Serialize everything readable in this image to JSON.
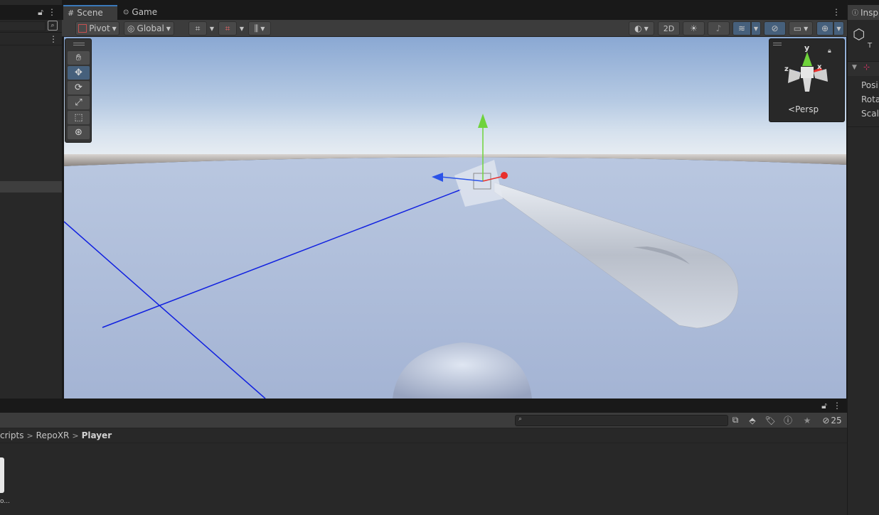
{
  "tabs": {
    "scene_label": "Scene",
    "game_label": "Game",
    "inspector_label": "Insp"
  },
  "toolbar": {
    "pivot_label": "Pivot",
    "global_label": "Global",
    "mode_2d_label": "2D"
  },
  "gizmo": {
    "x_label": "x",
    "y_label": "y",
    "z_label": "z",
    "projection_label": "Persp"
  },
  "inspector": {
    "position_label": "Posi",
    "rotation_label": "Rota",
    "scale_label": "Scal",
    "component_letter": "T"
  },
  "project": {
    "breadcrumb": [
      "cripts",
      "RepoXR",
      "Player"
    ],
    "hidden_count": "25",
    "asset_name_partial": "o..."
  },
  "colors": {
    "accent_blue": "#3a79bb",
    "axis_x": "#e8302d",
    "axis_y": "#6fd33b",
    "axis_z": "#2b53e8",
    "sky_top": "#8ba9d3",
    "ground": "#a9b8d6"
  }
}
